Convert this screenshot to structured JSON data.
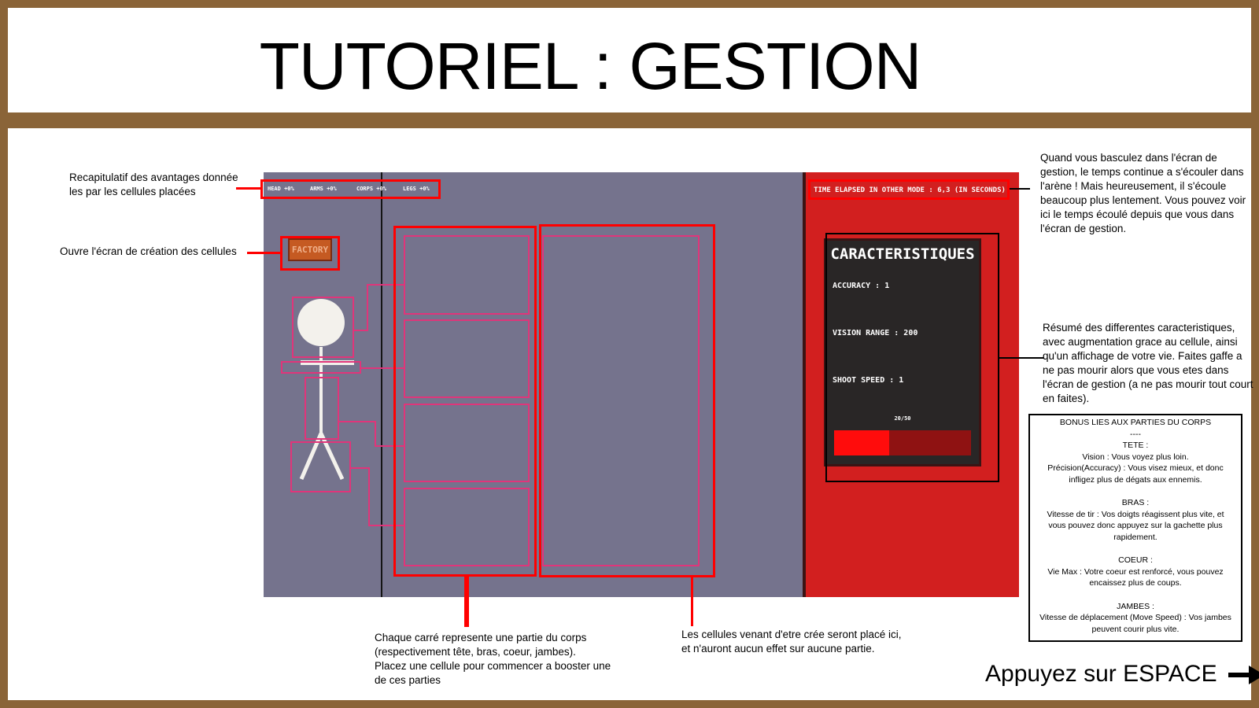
{
  "title": "TUTORIEL : GESTION",
  "game": {
    "bonuses": [
      "HEAD +0%",
      "ARMS +0%",
      "CORPS +0%",
      "LEGS +0%"
    ],
    "factory_label": "FACTORY",
    "time_elapsed": "TIME ELAPSED IN OTHER MODE : 6,3 (IN SECONDS)",
    "stats_title": "CARACTERISTIQUES",
    "accuracy": "ACCURACY : 1",
    "vision_range": "VISION RANGE : 200",
    "shoot_speed": "SHOOT SPEED : 1",
    "hp_text": "20/50",
    "hp_fraction": 0.4
  },
  "annotations": {
    "recap": "Recapitulatif des avantages donnée\n les par les cellules placées",
    "factory": "Ouvre l'écran de création des cellules",
    "time": "Quand vous basculez dans l'écran de gestion, le temps continue a s'écouler dans l'arène ! Mais heureusement, il s'écoule beaucoup plus lentement. Vous pouvez voir ici le temps écoulé depuis que vous dans l'écran de gestion.",
    "summary": "Résumé des differentes caracteristiques, avec augmentation grace au cellule, ainsi qu'un affichage de votre vie. Faites gaffe a ne pas mourir alors que vous etes dans l'écran de gestion (a ne pas mourir tout court en faites).",
    "squares": "Chaque carré represente une partie du corps\n(respectivement tête, bras, coeur, jambes).\nPlacez une cellule pour commencer a booster une\nde ces parties",
    "cells": "Les cellules venant d'etre crée seront placé ici,\net n'auront aucun effet sur aucune partie."
  },
  "bonus_box": [
    "BONUS LIES AUX PARTIES DU CORPS\n----\nTETE :",
    "Vision : Vous voyez plus loin.\nPrécision(Accuracy) : Vous visez mieux, et donc\ninfligez plus de dégats aux ennemis.",
    "\nBRAS :",
    "Vitesse de tir : Vos doigts réagissent plus vite, et\nvous pouvez donc appuyez sur la gachette plus\nrapidement.",
    "\nCOEUR :",
    "Vie Max : Votre coeur est renforcé, vous pouvez\nencaissez plus de coups.",
    "\nJAMBES :",
    "Vitesse de déplacement (Move Speed) : Vos jambes\npeuvent courir plus vite."
  ],
  "continue_label": "Appuyez sur ESPACE",
  "colors": {
    "frame": "#8a6438",
    "game_bg": "#75738d",
    "panel_red": "#d21f1f",
    "highlight": "#ff0000",
    "slot_pink": "#e0357a"
  },
  "icons": [
    "stick-figure-icon",
    "arrow-right-icon"
  ]
}
